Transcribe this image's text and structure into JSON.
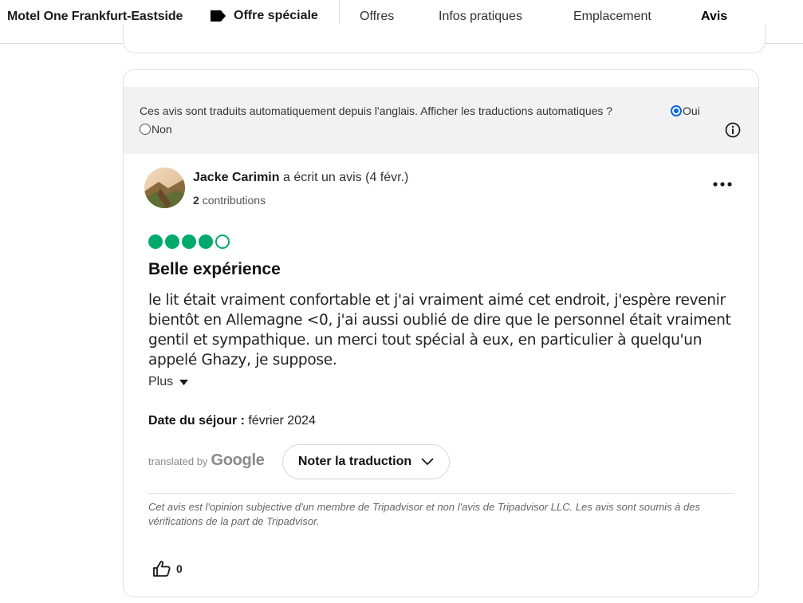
{
  "header": {
    "hotel_name": "Motel One Frankfurt-Eastside",
    "special_offer": "Offre spéciale",
    "tabs": [
      {
        "label": "Offres",
        "active": false
      },
      {
        "label": "Infos pratiques",
        "active": false
      },
      {
        "label": "Emplacement",
        "active": false
      },
      {
        "label": "Avis",
        "active": true
      }
    ]
  },
  "translation_bar": {
    "message": "Ces avis sont traduits automatiquement depuis l'anglais. Afficher les traductions automatiques ?",
    "option_yes": "Oui",
    "option_no": "Non",
    "selected": "Oui",
    "info_icon": "info-icon"
  },
  "review": {
    "author": "Jacke Carimin",
    "wrote_text": "a écrit un avis (4 févr.)",
    "contributions_count": "2",
    "contributions_label": "contributions",
    "rating": 4,
    "rating_max": 5,
    "rating_color": "#00aa6c",
    "title": "Belle expérience",
    "body": "le lit était vraiment confortable et j'ai vraiment aimé cet endroit, j'espère revenir bientôt en Allemagne <0, j'ai aussi oublié de dire que le personnel était vraiment gentil et sympathique. un merci tout spécial à eux, en particulier à quelqu'un appelé Ghazy, je suppose.",
    "more_label": "Plus",
    "stay_date_label": "Date du séjour :",
    "stay_date_value": "février 2024",
    "translated_by_label": "translated by",
    "translated_by_brand": "Google",
    "rate_translation_label": "Noter la traduction",
    "disclaimer": "Cet avis est l'opinion subjective d'un membre de Tripadvisor et non l'avis de Tripadvisor LLC. Les avis sont soumis à des vérifications de la part de Tripadvisor.",
    "helpful_count": "0"
  }
}
